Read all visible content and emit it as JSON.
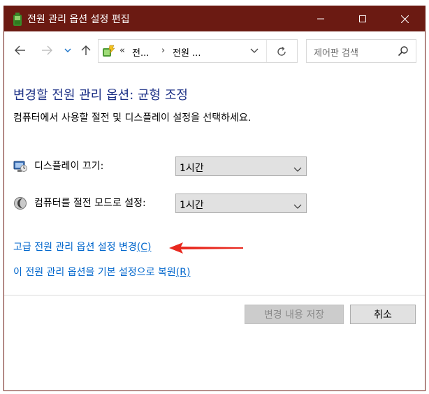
{
  "window": {
    "title": "전원 관리 옵션 설정 편집",
    "minimize_glyph": "—",
    "maximize_glyph": "☐",
    "close_glyph": "✕",
    "titlebar_color": "#6b1a12"
  },
  "navbar": {
    "back_icon": "arrow-left-icon",
    "forward_icon": "arrow-right-icon",
    "recent_icon": "chevron-down-icon",
    "up_icon": "arrow-up-icon",
    "address": {
      "icon": "power-options-icon",
      "overflow": "«",
      "crumbs": [
        "전...",
        "전원 ..."
      ],
      "separator": "›"
    },
    "search": {
      "placeholder": "제어판 검색",
      "icon": "search-icon"
    }
  },
  "main": {
    "heading": "변경할 전원 관리 옵션: 균형 조정",
    "description": "컴퓨터에서 사용할 절전 및 디스플레이 설정을 선택하세요.",
    "settings": [
      {
        "label": "디스플레이 끄기:",
        "value": "1시간",
        "icon": "display-off-icon"
      },
      {
        "label": "컴퓨터를 절전 모드로 설정:",
        "value": "1시간",
        "icon": "sleep-moon-icon"
      }
    ],
    "links": [
      {
        "text": "고급 전원 관리 옵션 설정 변경",
        "accel": "(C)"
      },
      {
        "text": "이 전원 관리 옵션을 기본 설정으로 복원",
        "accel": "(R)"
      }
    ],
    "annotation": {
      "icon": "red-arrow-icon",
      "color": "#e8281e"
    }
  },
  "footer": {
    "save_label": "변경 내용 저장",
    "cancel_label": "취소"
  }
}
